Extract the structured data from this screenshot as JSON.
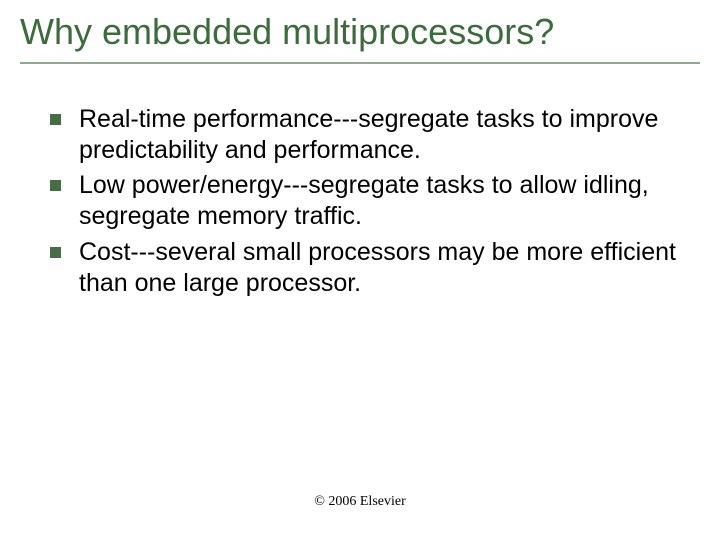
{
  "slide": {
    "title": "Why embedded multiprocessors?",
    "bullets": [
      "Real-time performance---segregate tasks to improve predictability and performance.",
      "Low power/energy---segregate tasks to allow idling, segregate memory traffic.",
      "Cost---several small processors may be more efficient than one large processor."
    ],
    "footer": "© 2006 Elsevier"
  }
}
